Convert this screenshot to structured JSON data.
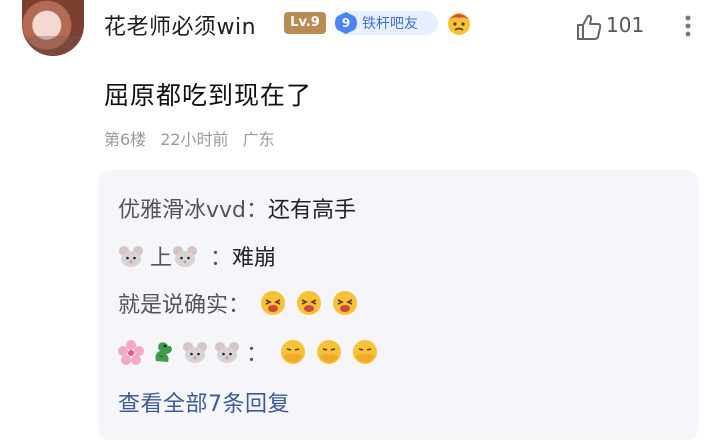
{
  "post": {
    "username": "花老师必须win",
    "level_badge": "Lv.9",
    "fan_badge": {
      "number": "9",
      "label": "铁杆吧友"
    },
    "like_count": "101",
    "content": "屈原都吃到现在了",
    "floor": "第6楼",
    "time": "22小时前",
    "location": "广东"
  },
  "replies": [
    {
      "author": "优雅滑冰vvd",
      "separator": "：",
      "text": "还有高手"
    },
    {
      "author_text": "上",
      "separator": "：",
      "text": "难崩"
    },
    {
      "author": "就是说确实",
      "separator": "："
    },
    {
      "separator": "："
    }
  ],
  "view_all_label": "查看全部7条回复",
  "colors": {
    "accent_link": "#3a5a9b",
    "fan_badge_blue": "#4a83f2",
    "level_gold": "#b88c54",
    "reply_bg": "#f6f6fa"
  },
  "icons": [
    "thumbs-up-icon",
    "more-dots-icon",
    "mouse-emoji",
    "cherry-blossom-emoji",
    "dragon-emoji",
    "laughing-emoji",
    "facepalm-emoji",
    "worried-emoji"
  ]
}
